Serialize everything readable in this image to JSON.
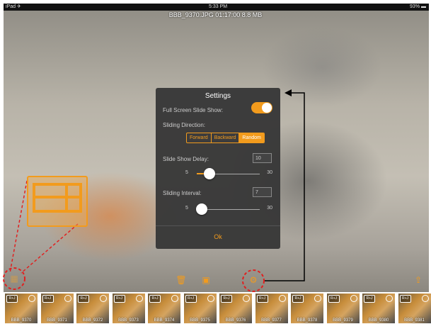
{
  "status": {
    "left": "iPad ✈",
    "time": "5:33 PM",
    "battery": "93% ▬"
  },
  "file_info": "BBB_9370.JPG 01:17:00 8.8 MB",
  "settings": {
    "title": "Settings",
    "fullscreen_label": "Full Screen Slide Show:",
    "fullscreen_on": true,
    "direction_label": "Sliding Direction:",
    "direction_options": [
      "Forward",
      "Backward",
      "Random"
    ],
    "direction_selected": "Random",
    "delay_label": "Slide Show Delay:",
    "delay_value": "10",
    "delay_min": "5",
    "delay_max": "30",
    "delay_slider": 10,
    "interval_label": "Sliding Interval:",
    "interval_value": "7",
    "interval_min": "5",
    "interval_max": "30",
    "interval_slider": 7,
    "ok_label": "Ok"
  },
  "icons": {
    "delete": "trash-icon",
    "gallery": "image-icon",
    "settings": "gear-icon",
    "share": "share-icon",
    "layout": "grid-layout-icon"
  },
  "thumbnails": [
    "BBB_9370",
    "BBB_9371",
    "BBB_9372",
    "BBB_9373",
    "BBB_9374",
    "BBB_9375",
    "BBB_9376",
    "BBB_9377",
    "BBB_9378",
    "BBB_9379",
    "BBB_9380",
    "BBB_9381"
  ],
  "colors": {
    "accent": "#f29b1d",
    "annotation": "#e02020"
  }
}
